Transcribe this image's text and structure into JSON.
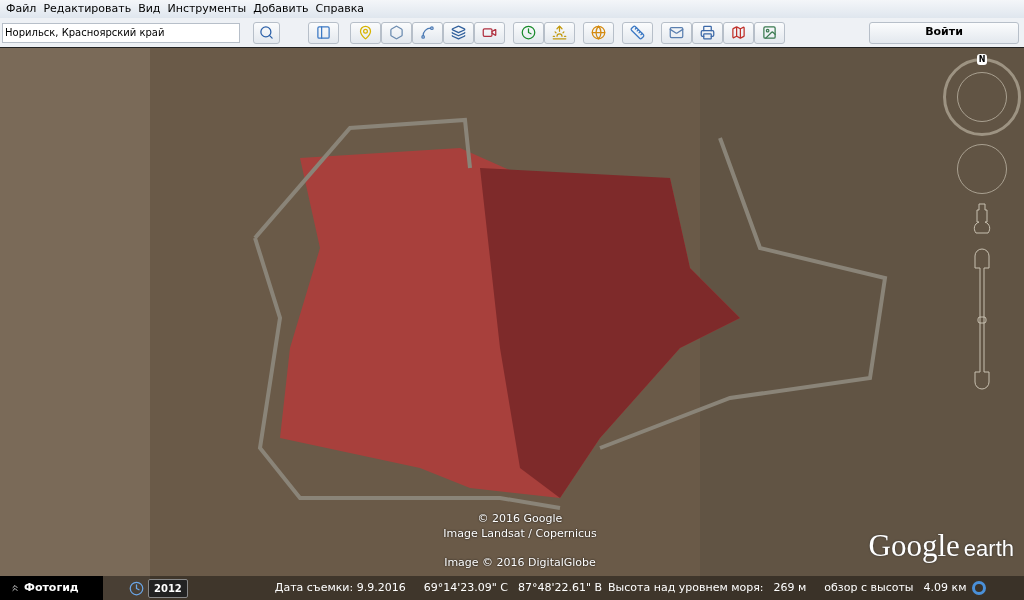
{
  "menu": [
    "Файл",
    "Редактировать",
    "Вид",
    "Инструменты",
    "Добавить",
    "Справка"
  ],
  "search": {
    "value": "Норильск, Красноярский край"
  },
  "login_button": "Войти",
  "compass": {
    "north_label": "N"
  },
  "zoom_slider": {
    "level": 0.5
  },
  "credits": [
    "© 2016 Google",
    "Image Landsat / Copernicus",
    "Image © 2016 DigitalGlobe"
  ],
  "logo": {
    "word": "Google",
    "product": "earth"
  },
  "status_bar": {
    "photo_guide": "Фотогид",
    "history_year": "2012",
    "capture_date": "Дата съемки: 9.9.2016",
    "latitude": "69°14'23.09\" С",
    "longitude": "87°48'22.61\" В",
    "elevation_label": "Высота над уровнем моря:",
    "elevation": "269 м",
    "eye_alt_label": "обзор с высоты",
    "eye_alt": "4.09 км"
  }
}
